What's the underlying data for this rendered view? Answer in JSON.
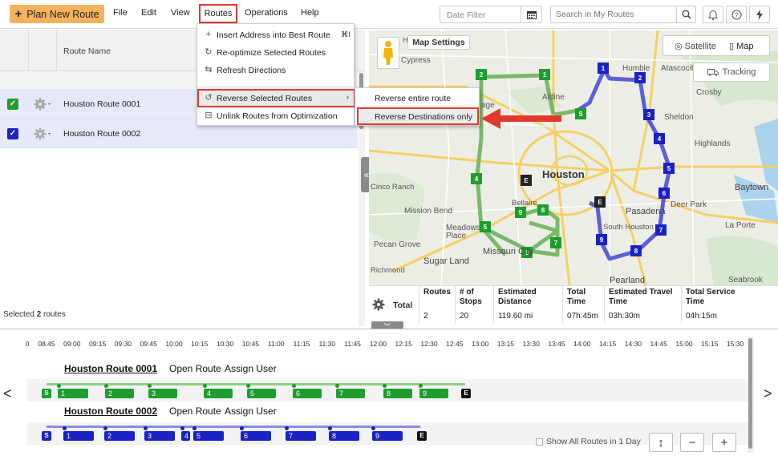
{
  "toolbar": {
    "plan_button": "Plan New Route",
    "menus": [
      "File",
      "Edit",
      "View",
      "Routes",
      "Operations",
      "Help"
    ],
    "date_filter_placeholder": "Date Filter",
    "search_placeholder": "Search in My Routes",
    "icons": [
      "bell-icon",
      "help-icon",
      "lightning-icon"
    ]
  },
  "routes_menu": {
    "items": [
      {
        "label": "Insert Address into Best Route",
        "shortcut": "⌘I"
      },
      {
        "label": "Re-optimize Selected Routes"
      },
      {
        "label": "Refresh Directions"
      },
      {
        "label": "Reverse Selected Routes"
      },
      {
        "label": "Unlink Routes from Optimization"
      }
    ],
    "submenu": [
      "Reverse entire route",
      "Reverse Destinations only"
    ]
  },
  "route_list": {
    "column_header": "Route Name",
    "rows": [
      {
        "name": "Houston Route 0001",
        "checked": true,
        "check_color": "#1f9d2e"
      },
      {
        "name": "Houston Route 0002",
        "checked": true,
        "check_color": "#1a22c4"
      }
    ],
    "selected_prefix": "Selected ",
    "selected_count": "2",
    "selected_suffix": " routes"
  },
  "map": {
    "settings_label": "Map Settings",
    "satellite_label": "Satellite",
    "map_label": "Map",
    "tracking_label": "Tracking",
    "place_labels": [
      {
        "text": "Hilshire"
      },
      {
        "text": "Cypress"
      },
      {
        "text": "Humble"
      },
      {
        "text": "Atascocita"
      },
      {
        "text": "Aldine"
      },
      {
        "text": "Crosby"
      },
      {
        "text": "Sheldon"
      },
      {
        "text": "Highlands"
      },
      {
        "text": "Houston"
      },
      {
        "text": "Baytown"
      },
      {
        "text": "Pasadena"
      },
      {
        "text": "Deer Park"
      },
      {
        "text": "Mission Bend"
      },
      {
        "text": "Meadows Place"
      },
      {
        "text": "Missouri City"
      },
      {
        "text": "Sugar Land"
      },
      {
        "text": "Pecan Grove"
      },
      {
        "text": "Pearland"
      },
      {
        "text": "La Porte"
      },
      {
        "text": "Seabrook"
      },
      {
        "text": "South Houston"
      },
      {
        "text": "Bellaire"
      },
      {
        "text": "Cinco Ranch"
      },
      {
        "text": "Richmond"
      },
      {
        "text": "age"
      }
    ],
    "green_route_color": "#1f9d2e",
    "blue_route_color": "#1a22c4"
  },
  "totals": {
    "row_label": "Total",
    "headers": [
      "Routes",
      "# of Stops",
      "Estimated Distance",
      "Total Time",
      "Estimated Travel Time",
      "Total Service Time"
    ],
    "values": [
      "2",
      "20",
      "119.60 mi",
      "07h:45m",
      "03h:30m",
      "04h:15m"
    ]
  },
  "timeline": {
    "ticks": [
      "0",
      "08:45",
      "09:00",
      "09:15",
      "09:30",
      "09:45",
      "10:00",
      "10:15",
      "10:30",
      "10:45",
      "11:00",
      "11:15",
      "11:30",
      "11:45",
      "12:00",
      "12:15",
      "12:30",
      "12:45",
      "13:00",
      "13:15",
      "13:30",
      "13:45",
      "14:00",
      "14:15",
      "14:30",
      "14:45",
      "15:00",
      "15:15",
      "15:30"
    ],
    "routes": [
      {
        "title": "Houston Route 0001",
        "open_label": "Open Route",
        "assign_label": "Assign User",
        "start": "S",
        "end": "E",
        "stops": [
          "1",
          "2",
          "3",
          "4",
          "5",
          "6",
          "7",
          "8",
          "9"
        ],
        "color": "#1f9d2e"
      },
      {
        "title": "Houston Route 0002",
        "open_label": "Open Route",
        "assign_label": "Assign User",
        "start": "S",
        "end": "E",
        "stops": [
          "1",
          "2",
          "3",
          "4",
          "5",
          "6",
          "7",
          "8",
          "9"
        ],
        "color": "#1a22c4"
      }
    ],
    "show_all_label": "Show All Routes in 1 Day",
    "prev": "<",
    "next": ">",
    "zoom_out": "−",
    "zoom_in": "+"
  }
}
